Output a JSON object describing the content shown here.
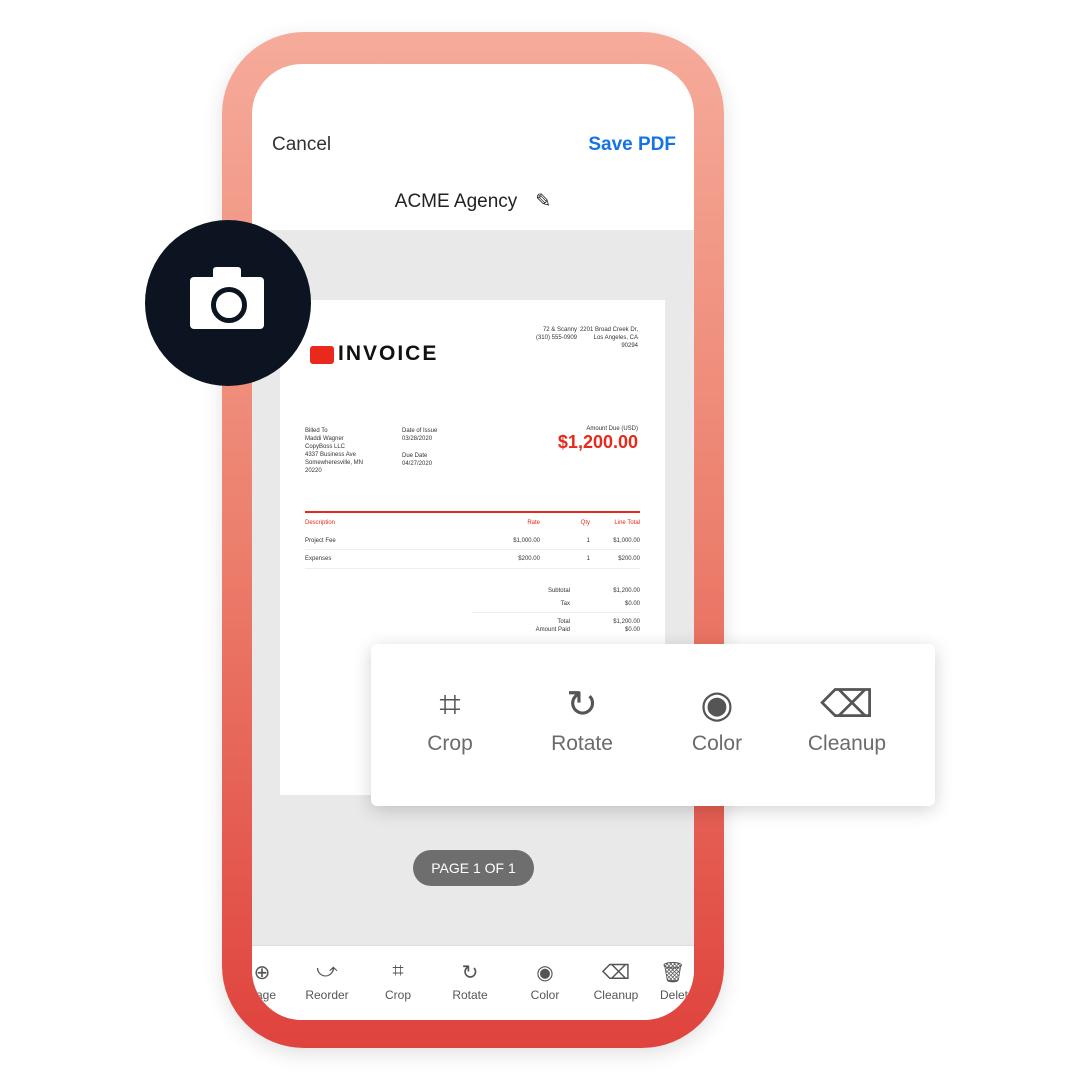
{
  "header": {
    "cancel": "Cancel",
    "save": "Save PDF",
    "doc_title": "ACME Agency"
  },
  "invoice": {
    "heading": "INVOICE",
    "company": "72 & Scanny\n(310) 555-0909",
    "address": "2201 Broad Creek Dr,\nLos Angeles, CA\n90294",
    "billed_to_label": "Billed To",
    "billed_to": "Maddi Wagner\nCopyBoss LLC\n4337 Business Ave\nSomewheresville, MN\n20220",
    "issue_label": "Date of Issue",
    "issue_date": "03/28/2020",
    "due_label": "Due Date",
    "due_date": "04/27/2020",
    "amount_label": "Amount Due (USD)",
    "amount": "$1,200.00",
    "columns": [
      "Description",
      "Rate",
      "Qty",
      "Line Total"
    ],
    "rows": [
      [
        "Project Fee",
        "$1,000.00",
        "1",
        "$1,000.00"
      ],
      [
        "Expenses",
        "$200.00",
        "1",
        "$200.00"
      ]
    ],
    "totals": [
      [
        "Subtotal",
        "$1,200.00"
      ],
      [
        "Tax",
        "$0.00"
      ],
      [
        "Total",
        "$1,200.00"
      ],
      [
        "Amount Paid",
        "$0.00"
      ]
    ]
  },
  "page_indicator": "PAGE 1 OF 1",
  "toolbar": [
    {
      "label": "Page",
      "icon": "add-page"
    },
    {
      "label": "Reorder",
      "icon": "reorder"
    },
    {
      "label": "Crop",
      "icon": "crop"
    },
    {
      "label": "Rotate",
      "icon": "rotate"
    },
    {
      "label": "Color",
      "icon": "color"
    },
    {
      "label": "Cleanup",
      "icon": "eraser"
    },
    {
      "label": "Delete",
      "icon": "trash"
    }
  ],
  "card": [
    {
      "label": "Crop",
      "icon": "crop"
    },
    {
      "label": "Rotate",
      "icon": "rotate"
    },
    {
      "label": "Color",
      "icon": "color"
    },
    {
      "label": "Cleanup",
      "icon": "eraser"
    }
  ],
  "colors": {
    "accent": "#1473e6",
    "invoice_red": "#e8291c",
    "camera_bg": "#0b1420"
  }
}
